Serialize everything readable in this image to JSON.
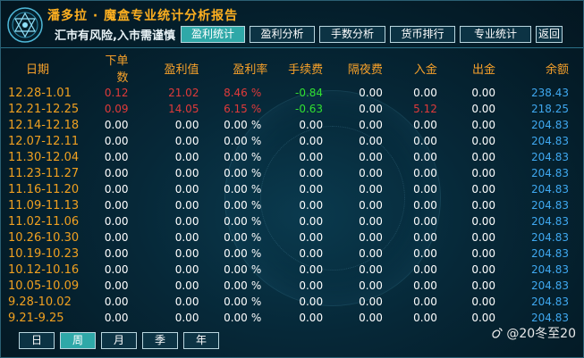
{
  "header": {
    "title": "潘多拉 · 魔盒专业统计分析报告",
    "subtitle": "汇市有风险,入市需谨慎 !",
    "tabs": [
      {
        "label": "盈利统计",
        "active": true
      },
      {
        "label": "盈利分析",
        "active": false
      },
      {
        "label": "手数分析",
        "active": false
      },
      {
        "label": "货币排行",
        "active": false
      },
      {
        "label": "专业统计",
        "active": false
      }
    ],
    "back_label": "返回"
  },
  "table": {
    "columns": [
      "日期",
      "下单数",
      "盈利值",
      "盈利率",
      "手续费",
      "隔夜费",
      "入金",
      "出金",
      "余额"
    ],
    "rows": [
      {
        "date": "12.28-1.01",
        "orders": "0.12",
        "profit": "21.02",
        "rate": "8.46",
        "pct": "%",
        "fee": "-0.84",
        "overnight": "0.00",
        "deposit": "0.00",
        "withdraw": "0.00",
        "balance": "238.43",
        "hl": "red",
        "fee_hl": "green",
        "dep_hl": "white"
      },
      {
        "date": "12.21-12.25",
        "orders": "0.09",
        "profit": "14.05",
        "rate": "6.15",
        "pct": "%",
        "fee": "-0.63",
        "overnight": "0.00",
        "deposit": "5.12",
        "withdraw": "0.00",
        "balance": "218.25",
        "hl": "red",
        "fee_hl": "green",
        "dep_hl": "red"
      },
      {
        "date": "12.14-12.18",
        "orders": "0.00",
        "profit": "0.00",
        "rate": "0.00",
        "pct": "%",
        "fee": "0.00",
        "overnight": "0.00",
        "deposit": "0.00",
        "withdraw": "0.00",
        "balance": "204.83",
        "hl": "white",
        "fee_hl": "white",
        "dep_hl": "white"
      },
      {
        "date": "12.07-12.11",
        "orders": "0.00",
        "profit": "0.00",
        "rate": "0.00",
        "pct": "%",
        "fee": "0.00",
        "overnight": "0.00",
        "deposit": "0.00",
        "withdraw": "0.00",
        "balance": "204.83",
        "hl": "white",
        "fee_hl": "white",
        "dep_hl": "white"
      },
      {
        "date": "11.30-12.04",
        "orders": "0.00",
        "profit": "0.00",
        "rate": "0.00",
        "pct": "%",
        "fee": "0.00",
        "overnight": "0.00",
        "deposit": "0.00",
        "withdraw": "0.00",
        "balance": "204.83",
        "hl": "white",
        "fee_hl": "white",
        "dep_hl": "white"
      },
      {
        "date": "11.23-11.27",
        "orders": "0.00",
        "profit": "0.00",
        "rate": "0.00",
        "pct": "%",
        "fee": "0.00",
        "overnight": "0.00",
        "deposit": "0.00",
        "withdraw": "0.00",
        "balance": "204.83",
        "hl": "white",
        "fee_hl": "white",
        "dep_hl": "white"
      },
      {
        "date": "11.16-11.20",
        "orders": "0.00",
        "profit": "0.00",
        "rate": "0.00",
        "pct": "%",
        "fee": "0.00",
        "overnight": "0.00",
        "deposit": "0.00",
        "withdraw": "0.00",
        "balance": "204.83",
        "hl": "white",
        "fee_hl": "white",
        "dep_hl": "white"
      },
      {
        "date": "11.09-11.13",
        "orders": "0.00",
        "profit": "0.00",
        "rate": "0.00",
        "pct": "%",
        "fee": "0.00",
        "overnight": "0.00",
        "deposit": "0.00",
        "withdraw": "0.00",
        "balance": "204.83",
        "hl": "white",
        "fee_hl": "white",
        "dep_hl": "white"
      },
      {
        "date": "11.02-11.06",
        "orders": "0.00",
        "profit": "0.00",
        "rate": "0.00",
        "pct": "%",
        "fee": "0.00",
        "overnight": "0.00",
        "deposit": "0.00",
        "withdraw": "0.00",
        "balance": "204.83",
        "hl": "white",
        "fee_hl": "white",
        "dep_hl": "white"
      },
      {
        "date": "10.26-10.30",
        "orders": "0.00",
        "profit": "0.00",
        "rate": "0.00",
        "pct": "%",
        "fee": "0.00",
        "overnight": "0.00",
        "deposit": "0.00",
        "withdraw": "0.00",
        "balance": "204.83",
        "hl": "white",
        "fee_hl": "white",
        "dep_hl": "white"
      },
      {
        "date": "10.19-10.23",
        "orders": "0.00",
        "profit": "0.00",
        "rate": "0.00",
        "pct": "%",
        "fee": "0.00",
        "overnight": "0.00",
        "deposit": "0.00",
        "withdraw": "0.00",
        "balance": "204.83",
        "hl": "white",
        "fee_hl": "white",
        "dep_hl": "white"
      },
      {
        "date": "10.12-10.16",
        "orders": "0.00",
        "profit": "0.00",
        "rate": "0.00",
        "pct": "%",
        "fee": "0.00",
        "overnight": "0.00",
        "deposit": "0.00",
        "withdraw": "0.00",
        "balance": "204.83",
        "hl": "white",
        "fee_hl": "white",
        "dep_hl": "white"
      },
      {
        "date": "10.05-10.09",
        "orders": "0.00",
        "profit": "0.00",
        "rate": "0.00",
        "pct": "%",
        "fee": "0.00",
        "overnight": "0.00",
        "deposit": "0.00",
        "withdraw": "0.00",
        "balance": "204.83",
        "hl": "white",
        "fee_hl": "white",
        "dep_hl": "white"
      },
      {
        "date": "9.28-10.02",
        "orders": "0.00",
        "profit": "0.00",
        "rate": "0.00",
        "pct": "%",
        "fee": "0.00",
        "overnight": "0.00",
        "deposit": "0.00",
        "withdraw": "0.00",
        "balance": "204.83",
        "hl": "white",
        "fee_hl": "white",
        "dep_hl": "white"
      },
      {
        "date": "9.21-9.25",
        "orders": "0.00",
        "profit": "0.00",
        "rate": "0.00",
        "pct": "%",
        "fee": "0.00",
        "overnight": "0.00",
        "deposit": "0.00",
        "withdraw": "0.00",
        "balance": "204.83",
        "hl": "white",
        "fee_hl": "white",
        "dep_hl": "white"
      }
    ]
  },
  "periods": [
    {
      "label": "日",
      "active": false
    },
    {
      "label": "周",
      "active": true
    },
    {
      "label": "月",
      "active": false
    },
    {
      "label": "季",
      "active": false
    },
    {
      "label": "年",
      "active": false
    }
  ],
  "watermark": {
    "text": "@20冬至20",
    "icon": "weibo-logo-icon"
  },
  "colors": {
    "accent": "#2fa8a8",
    "date": "#f0a020",
    "balance": "#3fa8f0",
    "loss": "#e03a3a",
    "fee": "#31e031",
    "title": "#ffb020"
  }
}
